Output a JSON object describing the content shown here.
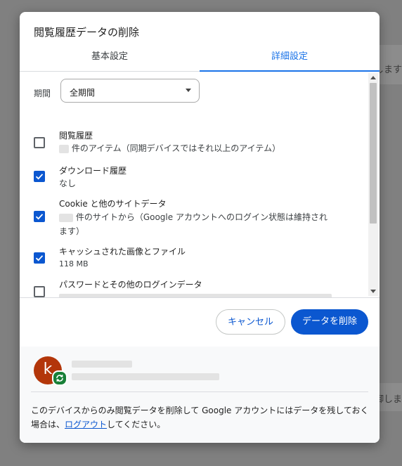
{
  "background": {
    "right_text_1": "します",
    "right_text_2": "御しま"
  },
  "dialog": {
    "title": "閲覧履歴データの削除",
    "tabs": [
      {
        "label": "基本設定"
      },
      {
        "label": "詳細設定"
      }
    ],
    "period": {
      "label": "期間",
      "selected": "全期間"
    },
    "items": [
      {
        "title": "閲覧履歴",
        "desc": "件のアイテム（同期デバイスではそれ以上のアイテム）",
        "checked": false
      },
      {
        "title": "ダウンロード履歴",
        "desc": "なし",
        "checked": true
      },
      {
        "title": "Cookie と他のサイトデータ",
        "desc_line1": "件のサイトから（Google アカウントへのログイン状態は維持され",
        "desc_line2": "ます）",
        "checked": true
      },
      {
        "title": "キャッシュされた画像とファイル",
        "desc": "118 MB",
        "checked": true
      },
      {
        "title": "パスワードとその他のログインデータ",
        "checked": false
      }
    ],
    "buttons": {
      "cancel": "キャンセル",
      "delete": "データを削除"
    },
    "account": {
      "avatar_letter": "k",
      "note_prefix": "このデバイスからのみ閲覧データを削除して Google アカウントにはデータを残しておく場合は、",
      "note_link": "ログアウト",
      "note_suffix": "してください。"
    },
    "colors": {
      "accent": "#0b57d0",
      "tab_active": "#1a73e8",
      "avatar": "#b3360a",
      "sync_badge": "#188038"
    }
  }
}
